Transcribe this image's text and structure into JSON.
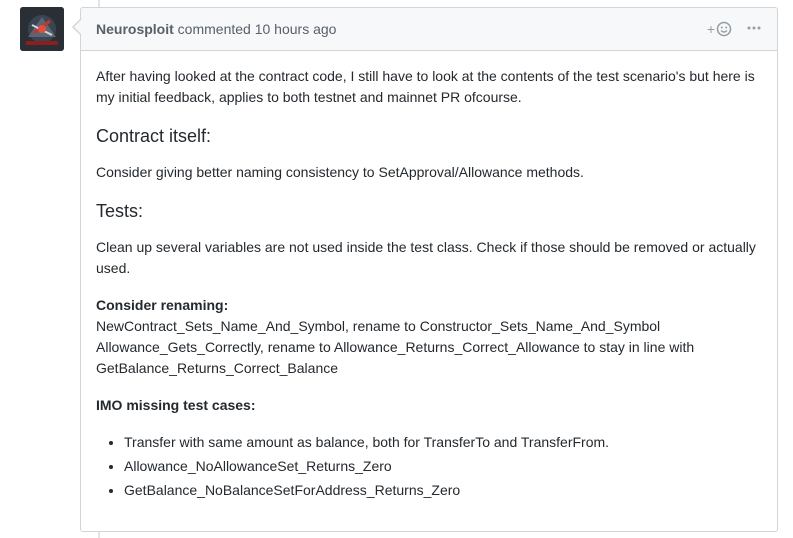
{
  "comment": {
    "author": "Neurosploit",
    "action": "commented",
    "time": "10 hours ago",
    "reaction_plus": "+",
    "more_label": "···"
  },
  "body": {
    "intro": "After having looked at the contract code, I still have to look at the contents of the test scenario's but here is my initial feedback, applies to both testnet and mainnet PR ofcourse.",
    "contract_heading": "Contract itself:",
    "contract_text": "Consider giving better naming consistency to SetApproval/Allowance methods.",
    "tests_heading": "Tests:",
    "tests_text": "Clean up several variables are not used inside the test class. Check if those should be removed or actually used.",
    "renaming_title": "Consider renaming:",
    "renaming_line1": "NewContract_Sets_Name_And_Symbol, rename to Constructor_Sets_Name_And_Symbol",
    "renaming_line2": "Allowance_Gets_Correctly, rename to Allowance_Returns_Correct_Allowance to stay in line with",
    "renaming_line3": "GetBalance_Returns_Correct_Balance",
    "missing_title": "IMO missing test cases:",
    "missing_items": [
      "Transfer with same amount as balance, both for TransferTo and TransferFrom.",
      "Allowance_NoAllowanceSet_Returns_Zero",
      "GetBalance_NoBalanceSetForAddress_Returns_Zero"
    ]
  },
  "icons": {
    "avatar": "avatar-image",
    "reaction": "smiley-icon",
    "more": "kebab-horizontal-icon"
  }
}
